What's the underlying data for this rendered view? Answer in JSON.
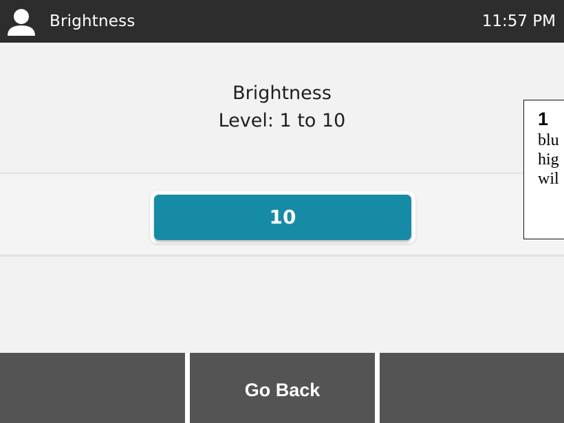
{
  "status_bar": {
    "title": "Brightness",
    "time": "11:57 PM",
    "user_icon": "user-icon"
  },
  "prompt": {
    "title": "Brightness",
    "range": "Level: 1 to 10"
  },
  "brightness_field": {
    "value": "10"
  },
  "callout": {
    "number": "1",
    "lines": [
      "blu",
      "hig",
      "wil"
    ]
  },
  "softkeys": [
    {
      "label": ""
    },
    {
      "label": "Go Back"
    },
    {
      "label": ""
    }
  ],
  "colors": {
    "status_bar_bg": "#2d2d2d",
    "field_bg": "#168ba6",
    "softkey_bg": "#545454",
    "screen_bg": "#f2f2f2"
  }
}
